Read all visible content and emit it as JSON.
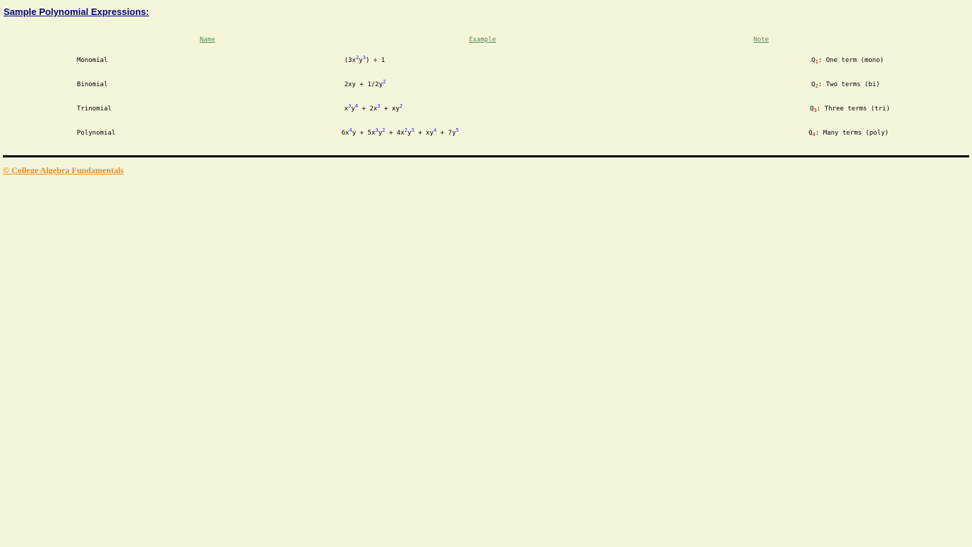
{
  "page_title": "Sample Polynomial Expressions:",
  "table": {
    "headers": {
      "name": "Name",
      "example": "Example",
      "note": "Note"
    },
    "rows": [
      {
        "name": "Monomial",
        "example_parts": [
          {
            "t": "(3x"
          },
          {
            "sup": "2"
          },
          {
            "t": "y"
          },
          {
            "sup": "3"
          },
          {
            "t": ") ÷ 1"
          }
        ],
        "q_label": "Q",
        "q_index": "1",
        "note": ": One term (mono)"
      },
      {
        "name": "Binomial",
        "example_parts": [
          {
            "t": "2xy + 1/2y"
          },
          {
            "sup": "2"
          }
        ],
        "q_label": "Q",
        "q_index": "2",
        "note": ": Two terms (bi)"
      },
      {
        "name": "Trinomial",
        "example_parts": [
          {
            "t": "x"
          },
          {
            "sup": "3"
          },
          {
            "t": "y"
          },
          {
            "sup": "4"
          },
          {
            "t": " + 2x"
          },
          {
            "sup": "3"
          },
          {
            "t": " + xy"
          },
          {
            "sup": "2"
          }
        ],
        "q_label": "Q",
        "q_index": "3",
        "note": ": Three terms (tri)"
      },
      {
        "name": "Polynomial",
        "example_parts": [
          {
            "t": "6x"
          },
          {
            "sup": "4"
          },
          {
            "t": "y + 5x"
          },
          {
            "sup": "3"
          },
          {
            "t": "y"
          },
          {
            "sup": "2"
          },
          {
            "t": " + 4x"
          },
          {
            "sup": "2"
          },
          {
            "t": "y"
          },
          {
            "sup": "3"
          },
          {
            "t": " + xy"
          },
          {
            "sup": "4"
          },
          {
            "t": " + 7y"
          },
          {
            "sup": "5"
          }
        ],
        "q_label": "Q",
        "q_index": "4",
        "note": ": Many terms (poly)"
      }
    ]
  },
  "footer": {
    "link_text": "© College Algebra Fundamentals"
  },
  "colors": {
    "background": "#f5f5dc",
    "title": "#000080",
    "header_link": "#5a8a5a",
    "exponent": "#1a1aff",
    "subscript": "#cc0000",
    "footer_link": "#f08c1e"
  }
}
